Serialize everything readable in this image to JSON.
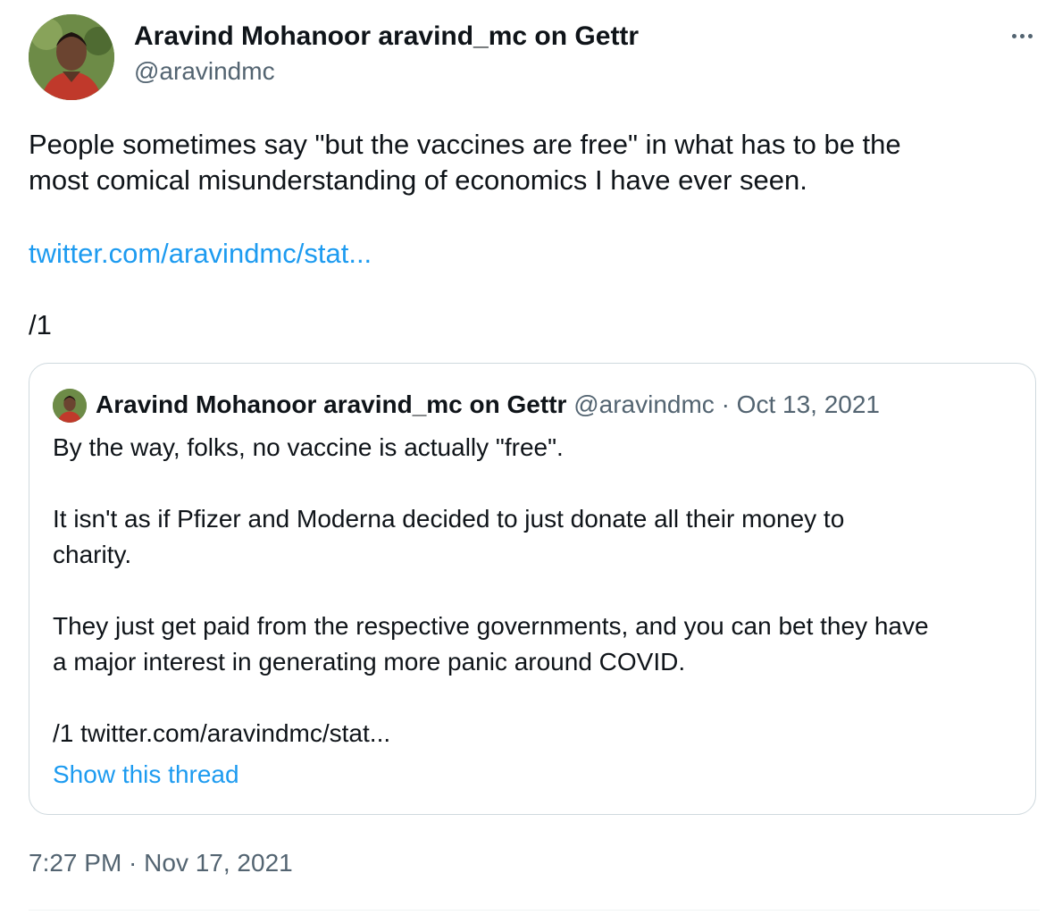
{
  "tweet": {
    "author_name": "Aravind Mohanoor aravind_mc on Gettr",
    "author_handle": "@aravindmc",
    "text_lines": [
      "People sometimes say \"but the vaccines are free\" in what has to be the",
      "most comical misunderstanding of economics I have ever seen."
    ],
    "link": "twitter.com/aravindmc/stat...",
    "thread_marker": "/1",
    "timestamp": "7:27 PM · Nov 17, 2021",
    "more_icon": "more-horizontal-icon"
  },
  "quoted_tweet": {
    "author_name": "Aravind Mohanoor aravind_mc on Gettr",
    "meta": "@aravindmc · Oct 13, 2021",
    "lines": [
      "By the way, folks, no vaccine is actually \"free\".",
      "It isn't as if Pfizer and Moderna decided to just donate all their money to",
      "charity.",
      "They just get paid from the respective governments, and you can bet they have",
      "a major interest in generating more panic around COVID.",
      "/1 twitter.com/aravindmc/stat..."
    ],
    "show_thread": "Show this thread"
  },
  "colors": {
    "link": "#1d9bf0",
    "secondary_text": "#536471",
    "border": "#cfd9de"
  }
}
